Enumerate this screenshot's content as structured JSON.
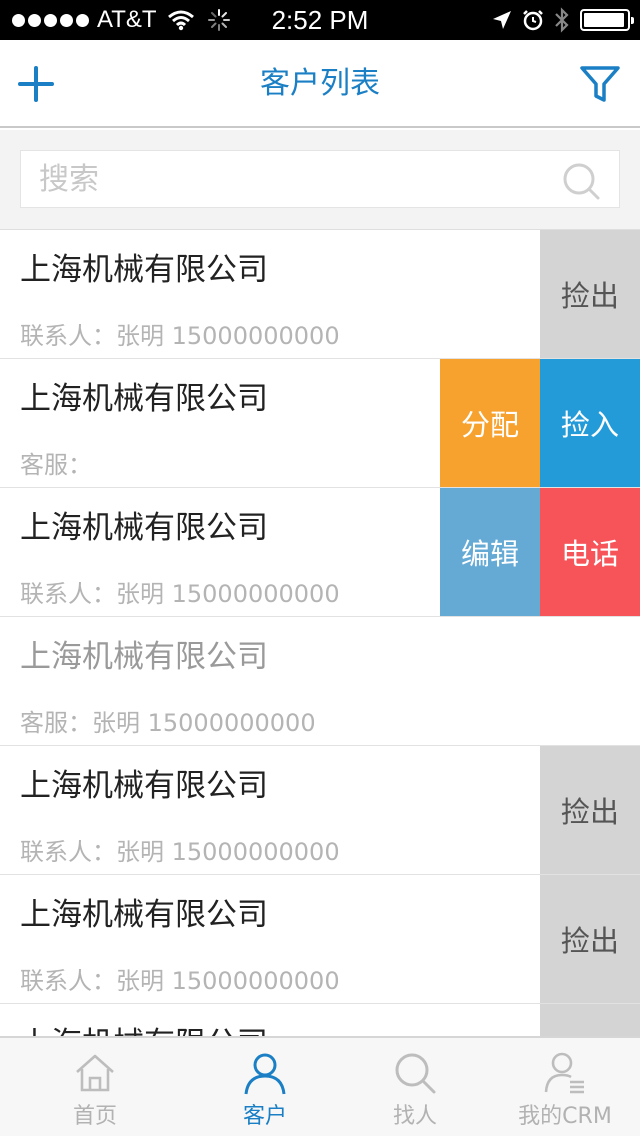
{
  "status_bar": {
    "carrier": "AT&T",
    "time": "2:52 PM",
    "battery_level": 0.95
  },
  "nav": {
    "title": "客户列表",
    "add_icon": "plus-icon",
    "filter_icon": "funnel-icon"
  },
  "search": {
    "placeholder": "搜索",
    "value": "",
    "icon": "search-icon"
  },
  "customers": [
    {
      "name": "上海机械有限公司",
      "sub": "联系人：张明 15000000000",
      "dim": false,
      "actions": [
        {
          "label": "捡出",
          "style": "gray"
        }
      ]
    },
    {
      "name": "上海机械有限公司",
      "sub": "客服：",
      "dim": false,
      "actions": [
        {
          "label": "分配",
          "style": "orange"
        },
        {
          "label": "捡入",
          "style": "blue"
        }
      ]
    },
    {
      "name": "上海机械有限公司",
      "sub": "联系人：张明 15000000000",
      "dim": false,
      "actions": [
        {
          "label": "编辑",
          "style": "lightblue"
        },
        {
          "label": "电话",
          "style": "red"
        }
      ]
    },
    {
      "name": "上海机械有限公司",
      "sub": "客服：张明 15000000000",
      "dim": true,
      "actions": []
    },
    {
      "name": "上海机械有限公司",
      "sub": "联系人：张明 15000000000",
      "dim": false,
      "actions": [
        {
          "label": "捡出",
          "style": "gray"
        }
      ]
    },
    {
      "name": "上海机械有限公司",
      "sub": "联系人：张明 15000000000",
      "dim": false,
      "actions": [
        {
          "label": "捡出",
          "style": "gray"
        }
      ]
    },
    {
      "name": "上海机械有限公司",
      "sub": "",
      "dim": false,
      "actions": [
        {
          "label": "",
          "style": "gray"
        }
      ]
    }
  ],
  "tabs": [
    {
      "label": "首页",
      "icon": "home-icon",
      "active": false
    },
    {
      "label": "客户",
      "icon": "person-icon",
      "active": true
    },
    {
      "label": "找人",
      "icon": "search-icon",
      "active": false
    },
    {
      "label": "我的CRM",
      "icon": "user-list-icon",
      "active": false
    }
  ],
  "colors": {
    "accent": "#1a7fc4",
    "orange": "#f7a22e",
    "blue": "#249bd9",
    "light_blue": "#64aad5",
    "red": "#f7545a",
    "gray": "#d4d4d4"
  }
}
